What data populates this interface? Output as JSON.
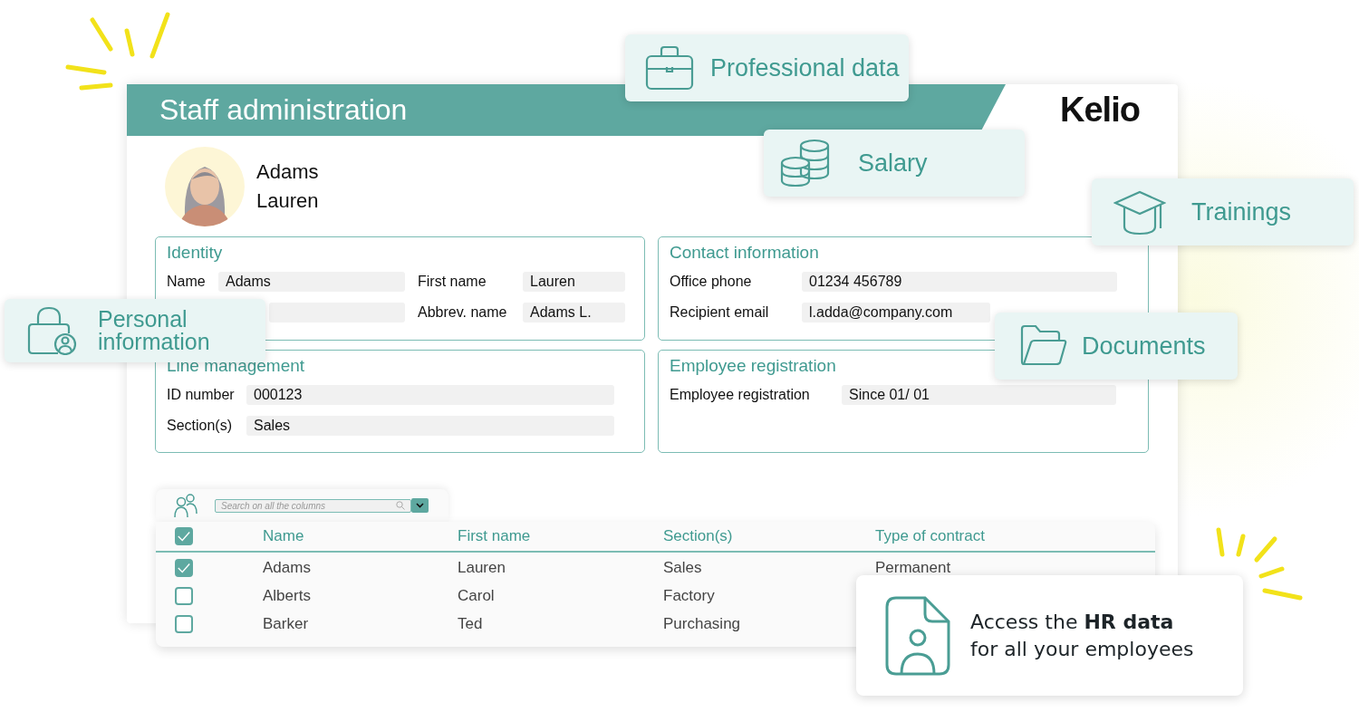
{
  "window": {
    "title": "Staff administration",
    "logo": "Kelio"
  },
  "profile": {
    "last_name": "Adams",
    "first_name": "Lauren"
  },
  "sections": [
    {
      "title": "Identity",
      "fields": [
        {
          "kind": "text",
          "label": "Name",
          "value": "Adams"
        },
        {
          "kind": "text",
          "label": "First name",
          "value": "Lauren"
        },
        {
          "kind": "blank"
        },
        {
          "kind": "text",
          "label": "Abbrev. name",
          "value": "Adams L."
        }
      ]
    },
    {
      "title": "Contact information",
      "fields": [
        {
          "kind": "text",
          "label": "Office phone",
          "value": "01234 456789"
        },
        {
          "kind": "text",
          "label": "Recipient email",
          "value": "l.adda@company.com"
        }
      ]
    },
    {
      "title": "Line management",
      "fields": [
        {
          "kind": "text",
          "label": "ID number",
          "value": "000123"
        },
        {
          "kind": "text",
          "label": "Section(s)",
          "value": "Sales"
        }
      ]
    },
    {
      "title": "Employee registration",
      "fields": [
        {
          "kind": "text",
          "label": "Employee registration",
          "value": "Since 01/ 01"
        }
      ]
    }
  ],
  "table": {
    "search": {
      "placeholder": "Search on all the columns"
    },
    "select_all": {
      "checked": true
    },
    "columns": [
      "Name",
      "First name",
      "Section(s)",
      "Type of contract"
    ],
    "rows": [
      {
        "checked": true,
        "cells": [
          "Adams",
          "Lauren",
          "Sales",
          "Permanent"
        ]
      },
      {
        "checked": false,
        "cells": [
          "Alberts",
          "Carol",
          "Factory"
        ]
      },
      {
        "checked": false,
        "cells": [
          "Barker",
          "Ted",
          "Purchasing"
        ]
      }
    ]
  },
  "callouts": [
    {
      "kind": "briefcase",
      "label": "Professional data"
    },
    {
      "kind": "coins",
      "label": "Salary"
    },
    {
      "kind": "cap",
      "label": "Trainings"
    },
    {
      "kind": "lock",
      "label": "Personal information"
    },
    {
      "kind": "folder",
      "label": "Documents"
    }
  ],
  "promo": {
    "lines": [
      "Access the **HR data**",
      "for all your employees"
    ]
  }
}
